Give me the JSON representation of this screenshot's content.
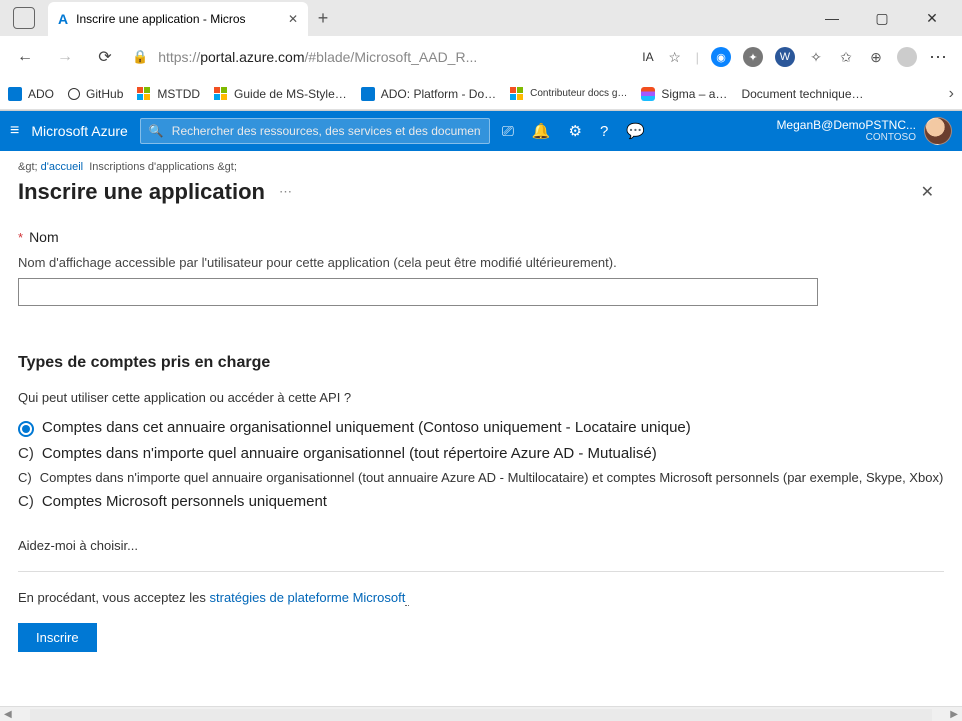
{
  "browser": {
    "tab_title": "Inscrire une application - Micros",
    "url_prefix": "https://",
    "url_host": "portal.azure.com",
    "url_path": "/#blade/Microsoft_AAD_R...",
    "ia_label": "IA",
    "favorites": [
      {
        "icon": "ado",
        "label": "ADO"
      },
      {
        "icon": "gh",
        "label": "GitHub"
      },
      {
        "icon": "ms",
        "label": "MSTDD"
      },
      {
        "icon": "ms",
        "label": "Guide de MS-Style…"
      },
      {
        "icon": "ado",
        "label": "ADO: Platform - Do…"
      },
      {
        "icon": "ms",
        "label": "Contributeur docs g…"
      },
      {
        "icon": "figma",
        "label": "Sigma – a…"
      },
      {
        "icon": "",
        "label": "Document technique…"
      }
    ]
  },
  "azure_header": {
    "brand": "Microsoft Azure",
    "search_placeholder": "Rechercher des ressources, des services et des documents (G+/)",
    "user_name": "MeganB@DemoPSTNC...",
    "directory": "CONTOSO"
  },
  "page": {
    "breadcrumb_home": "d'accueil",
    "breadcrumb_gt": "&gt;",
    "breadcrumb_item": "Inscriptions d'applications",
    "title": "Inscrire une application",
    "name_label": "Nom",
    "name_help": "Nom d'affichage accessible par l'utilisateur pour cette application (cela peut être modifié ultérieurement).",
    "name_value": "",
    "account_types_heading": "Types de comptes pris en charge",
    "account_types_sub": "Qui peut utiliser cette application ou accéder à cette API ?",
    "radios": [
      "Comptes dans cet annuaire organisationnel uniquement (Contoso uniquement - Locataire unique)",
      "Comptes dans n'importe quel annuaire organisationnel (tout répertoire Azure AD - Mutualisé)",
      "Comptes dans n'importe quel annuaire organisationnel (tout annuaire Azure AD - Multilocataire) et comptes Microsoft personnels (par exemple, Skype, Xbox)",
      "Comptes Microsoft personnels uniquement"
    ],
    "help_choose": "Aidez-moi à choisir...",
    "policy_prefix": "En procédant, vous acceptez les ",
    "policy_link": "stratégies de plateforme Microsoft",
    "register_btn": "Inscrire"
  }
}
